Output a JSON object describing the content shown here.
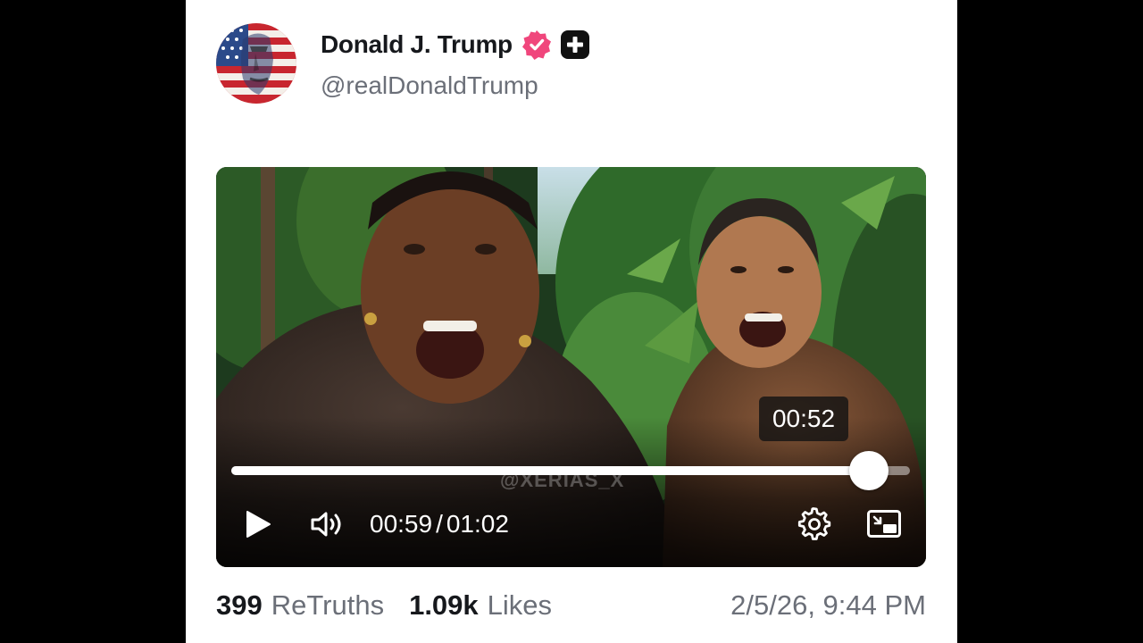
{
  "post": {
    "display_name": "Donald J. Trump",
    "handle": "@realDonaldTrump",
    "verified_color": "#f0467c",
    "avatar_icon": "us-flag-portrait-avatar",
    "plus_badge_icon": "plus-icon"
  },
  "video": {
    "watermark": "@XERIAS_X",
    "hover_time": "00:52",
    "current_time": "00:59",
    "separator": "/",
    "duration": "01:02",
    "progress": 0.94,
    "icons": {
      "play": "play-icon",
      "volume": "volume-icon",
      "settings": "gear-icon",
      "pip": "picture-in-picture-icon"
    }
  },
  "stats": {
    "retruths_count": "399",
    "retruths_label": "ReTruths",
    "likes_count": "1.09k",
    "likes_label": "Likes",
    "timestamp": "2/5/26, 9:44 PM"
  }
}
